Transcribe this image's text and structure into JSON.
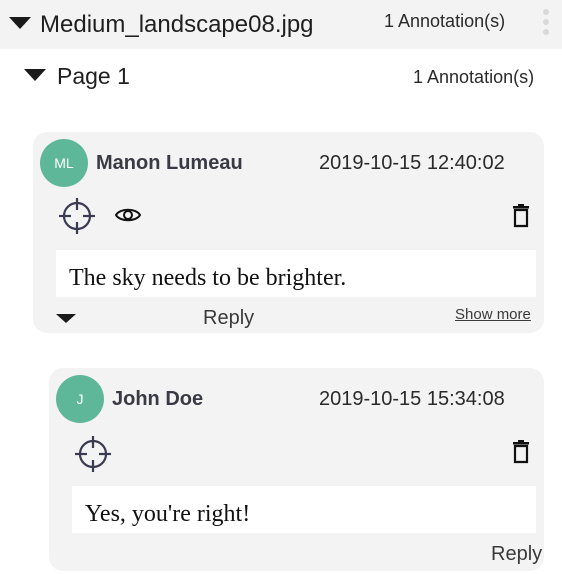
{
  "file": {
    "name": "Medium_landscape08.jpg",
    "annotation_count": "1 Annotation(s)"
  },
  "page": {
    "label": "Page 1",
    "annotation_count": "1 Annotation(s)"
  },
  "annotations": [
    {
      "initials": "ML",
      "author": "Manon Lumeau",
      "timestamp": "2019-10-15 12:40:02",
      "comment": "The sky needs to be brighter.",
      "reply_label": "Reply",
      "show_more_label": "Show more",
      "icons": [
        "crosshair-icon",
        "eye-icon",
        "trash-icon",
        "chevron-down-icon"
      ]
    },
    {
      "initials": "J",
      "author": "John Doe",
      "timestamp": "2019-10-15 15:34:08",
      "comment": "Yes, you're right!",
      "reply_label": "Reply",
      "icons": [
        "crosshair-icon",
        "trash-icon"
      ]
    }
  ],
  "colors": {
    "avatar": "#5db798",
    "card_background": "#f3f3f3",
    "header_background": "#f3f3f3"
  }
}
